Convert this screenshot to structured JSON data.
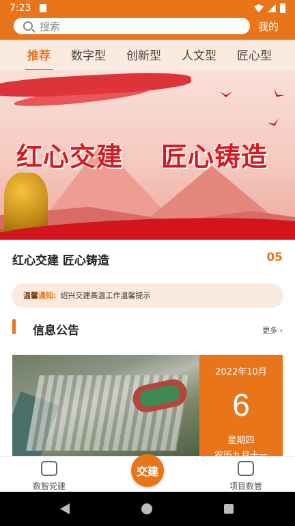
{
  "status_bar": {
    "time": "7:23"
  },
  "search": {
    "placeholder": "搜索",
    "me_label": "我的"
  },
  "tabs": [
    {
      "label": "推荐",
      "active": true
    },
    {
      "label": "数字型"
    },
    {
      "label": "创新型"
    },
    {
      "label": "人文型"
    },
    {
      "label": "匠心型"
    }
  ],
  "banner": {
    "slogan_left": "红心交建",
    "slogan_right": "匠心铸造",
    "caption": "红心交建 匠心铸造",
    "index": "05"
  },
  "notice": {
    "badge_part1": "温馨",
    "badge_part2": "通知:",
    "text": "绍兴交建高温工作温馨提示"
  },
  "section": {
    "title": "信息公告",
    "more_label": "更多 ›"
  },
  "news_card": {
    "year_month": "2022年10月",
    "day": "6",
    "weekday": "星期四",
    "lunar": "农历九月十一"
  },
  "bottom_nav": {
    "left_label": "数智党建",
    "center_label": "交建",
    "right_label": "项目数管"
  },
  "colors": {
    "brand": "#e9751b",
    "tab_bg": "#fbeadf"
  }
}
